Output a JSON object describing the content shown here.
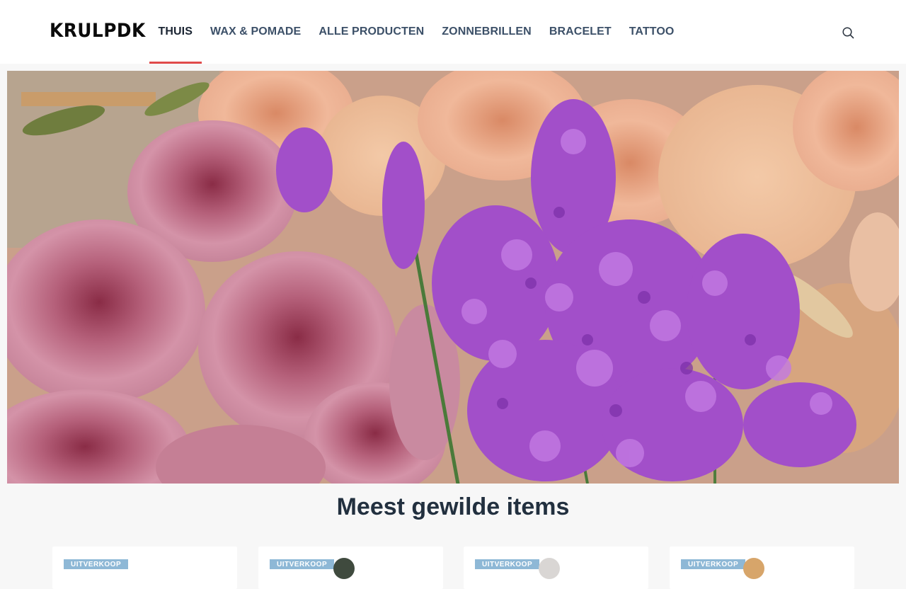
{
  "brand": {
    "logo_text": "KRULPDK"
  },
  "nav": {
    "items": [
      {
        "label": "THUIS",
        "active": true
      },
      {
        "label": "WAX & POMADE",
        "active": false
      },
      {
        "label": "ALLE PRODUCTEN",
        "active": false
      },
      {
        "label": "ZONNEBRILLEN",
        "active": false
      },
      {
        "label": "BRACELET",
        "active": false
      },
      {
        "label": "TATTOO",
        "active": false
      }
    ],
    "search_icon": "search-icon"
  },
  "hero": {
    "image": "flowers-roses-lavender-banner"
  },
  "section": {
    "title": "Meest gewilde items"
  },
  "products": [
    {
      "badge": "UITVERKOOP",
      "thumb_color": ""
    },
    {
      "badge": "UITVERKOOP",
      "thumb_color": "#3f4a3e"
    },
    {
      "badge": "UITVERKOOP",
      "thumb_color": "#d9d6d4"
    },
    {
      "badge": "UITVERKOOP",
      "thumb_color": "#d7a56a"
    }
  ],
  "colors": {
    "accent": "#e04b4b",
    "nav_text": "#3c5068",
    "badge": "#8eb8d6"
  }
}
